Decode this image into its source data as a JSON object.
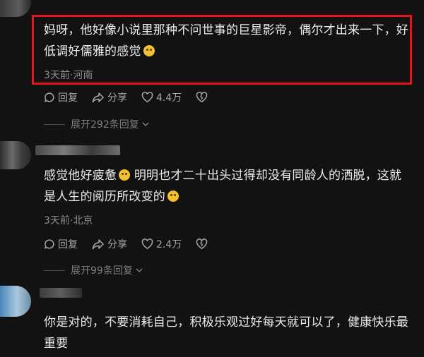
{
  "comments": [
    {
      "text": "妈呀，他好像小说里那种不问世事的巨星影帝，偶尔才出来一下，好低调好儒雅的感觉",
      "meta": "3天前·河南",
      "reply_label": "回复",
      "share_label": "分享",
      "likes": "4.4万",
      "expand_label": "展开292条回复"
    },
    {
      "text": "感觉他好疲惫",
      "text_2": "明明也才二十出头过得却没有同龄人的洒脱，这就是人生的阅历所改变的",
      "meta": "3天前·北京",
      "reply_label": "回复",
      "share_label": "分享",
      "likes": "2.4万",
      "expand_label": "展开99条回复"
    },
    {
      "text": "你是对的，不要消耗自己，积极乐观过好每天就可以了，健康快乐最重要"
    }
  ],
  "colors": {
    "highlight_border": "#e2151b",
    "background": "#121212"
  }
}
